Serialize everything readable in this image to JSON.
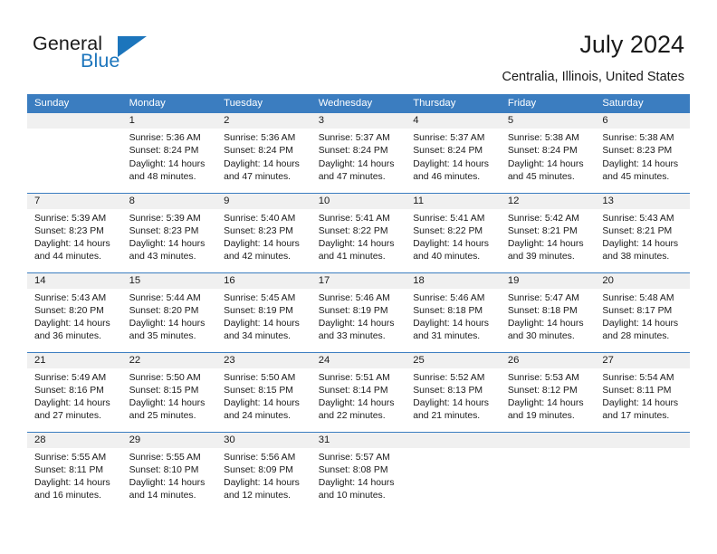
{
  "brand": {
    "name_part1": "General",
    "name_part2": "Blue"
  },
  "header": {
    "title": "July 2024",
    "location": "Centralia, Illinois, United States"
  },
  "colors": {
    "header_blue": "#3b7dc0",
    "brand_blue": "#1c75bc",
    "daynum_band": "#f0f0f0",
    "text": "#1a1a1a"
  },
  "weekdays": [
    "Sunday",
    "Monday",
    "Tuesday",
    "Wednesday",
    "Thursday",
    "Friday",
    "Saturday"
  ],
  "labels": {
    "sunrise_prefix": "Sunrise:",
    "sunset_prefix": "Sunset:",
    "daylight_prefix": "Daylight:"
  },
  "weeks": [
    [
      {
        "day": "",
        "blank": true
      },
      {
        "day": "1",
        "sunrise": "Sunrise: 5:36 AM",
        "sunset": "Sunset: 8:24 PM",
        "daylight1": "Daylight: 14 hours",
        "daylight2": "and 48 minutes."
      },
      {
        "day": "2",
        "sunrise": "Sunrise: 5:36 AM",
        "sunset": "Sunset: 8:24 PM",
        "daylight1": "Daylight: 14 hours",
        "daylight2": "and 47 minutes."
      },
      {
        "day": "3",
        "sunrise": "Sunrise: 5:37 AM",
        "sunset": "Sunset: 8:24 PM",
        "daylight1": "Daylight: 14 hours",
        "daylight2": "and 47 minutes."
      },
      {
        "day": "4",
        "sunrise": "Sunrise: 5:37 AM",
        "sunset": "Sunset: 8:24 PM",
        "daylight1": "Daylight: 14 hours",
        "daylight2": "and 46 minutes."
      },
      {
        "day": "5",
        "sunrise": "Sunrise: 5:38 AM",
        "sunset": "Sunset: 8:24 PM",
        "daylight1": "Daylight: 14 hours",
        "daylight2": "and 45 minutes."
      },
      {
        "day": "6",
        "sunrise": "Sunrise: 5:38 AM",
        "sunset": "Sunset: 8:23 PM",
        "daylight1": "Daylight: 14 hours",
        "daylight2": "and 45 minutes."
      }
    ],
    [
      {
        "day": "7",
        "sunrise": "Sunrise: 5:39 AM",
        "sunset": "Sunset: 8:23 PM",
        "daylight1": "Daylight: 14 hours",
        "daylight2": "and 44 minutes."
      },
      {
        "day": "8",
        "sunrise": "Sunrise: 5:39 AM",
        "sunset": "Sunset: 8:23 PM",
        "daylight1": "Daylight: 14 hours",
        "daylight2": "and 43 minutes."
      },
      {
        "day": "9",
        "sunrise": "Sunrise: 5:40 AM",
        "sunset": "Sunset: 8:23 PM",
        "daylight1": "Daylight: 14 hours",
        "daylight2": "and 42 minutes."
      },
      {
        "day": "10",
        "sunrise": "Sunrise: 5:41 AM",
        "sunset": "Sunset: 8:22 PM",
        "daylight1": "Daylight: 14 hours",
        "daylight2": "and 41 minutes."
      },
      {
        "day": "11",
        "sunrise": "Sunrise: 5:41 AM",
        "sunset": "Sunset: 8:22 PM",
        "daylight1": "Daylight: 14 hours",
        "daylight2": "and 40 minutes."
      },
      {
        "day": "12",
        "sunrise": "Sunrise: 5:42 AM",
        "sunset": "Sunset: 8:21 PM",
        "daylight1": "Daylight: 14 hours",
        "daylight2": "and 39 minutes."
      },
      {
        "day": "13",
        "sunrise": "Sunrise: 5:43 AM",
        "sunset": "Sunset: 8:21 PM",
        "daylight1": "Daylight: 14 hours",
        "daylight2": "and 38 minutes."
      }
    ],
    [
      {
        "day": "14",
        "sunrise": "Sunrise: 5:43 AM",
        "sunset": "Sunset: 8:20 PM",
        "daylight1": "Daylight: 14 hours",
        "daylight2": "and 36 minutes."
      },
      {
        "day": "15",
        "sunrise": "Sunrise: 5:44 AM",
        "sunset": "Sunset: 8:20 PM",
        "daylight1": "Daylight: 14 hours",
        "daylight2": "and 35 minutes."
      },
      {
        "day": "16",
        "sunrise": "Sunrise: 5:45 AM",
        "sunset": "Sunset: 8:19 PM",
        "daylight1": "Daylight: 14 hours",
        "daylight2": "and 34 minutes."
      },
      {
        "day": "17",
        "sunrise": "Sunrise: 5:46 AM",
        "sunset": "Sunset: 8:19 PM",
        "daylight1": "Daylight: 14 hours",
        "daylight2": "and 33 minutes."
      },
      {
        "day": "18",
        "sunrise": "Sunrise: 5:46 AM",
        "sunset": "Sunset: 8:18 PM",
        "daylight1": "Daylight: 14 hours",
        "daylight2": "and 31 minutes."
      },
      {
        "day": "19",
        "sunrise": "Sunrise: 5:47 AM",
        "sunset": "Sunset: 8:18 PM",
        "daylight1": "Daylight: 14 hours",
        "daylight2": "and 30 minutes."
      },
      {
        "day": "20",
        "sunrise": "Sunrise: 5:48 AM",
        "sunset": "Sunset: 8:17 PM",
        "daylight1": "Daylight: 14 hours",
        "daylight2": "and 28 minutes."
      }
    ],
    [
      {
        "day": "21",
        "sunrise": "Sunrise: 5:49 AM",
        "sunset": "Sunset: 8:16 PM",
        "daylight1": "Daylight: 14 hours",
        "daylight2": "and 27 minutes."
      },
      {
        "day": "22",
        "sunrise": "Sunrise: 5:50 AM",
        "sunset": "Sunset: 8:15 PM",
        "daylight1": "Daylight: 14 hours",
        "daylight2": "and 25 minutes."
      },
      {
        "day": "23",
        "sunrise": "Sunrise: 5:50 AM",
        "sunset": "Sunset: 8:15 PM",
        "daylight1": "Daylight: 14 hours",
        "daylight2": "and 24 minutes."
      },
      {
        "day": "24",
        "sunrise": "Sunrise: 5:51 AM",
        "sunset": "Sunset: 8:14 PM",
        "daylight1": "Daylight: 14 hours",
        "daylight2": "and 22 minutes."
      },
      {
        "day": "25",
        "sunrise": "Sunrise: 5:52 AM",
        "sunset": "Sunset: 8:13 PM",
        "daylight1": "Daylight: 14 hours",
        "daylight2": "and 21 minutes."
      },
      {
        "day": "26",
        "sunrise": "Sunrise: 5:53 AM",
        "sunset": "Sunset: 8:12 PM",
        "daylight1": "Daylight: 14 hours",
        "daylight2": "and 19 minutes."
      },
      {
        "day": "27",
        "sunrise": "Sunrise: 5:54 AM",
        "sunset": "Sunset: 8:11 PM",
        "daylight1": "Daylight: 14 hours",
        "daylight2": "and 17 minutes."
      }
    ],
    [
      {
        "day": "28",
        "sunrise": "Sunrise: 5:55 AM",
        "sunset": "Sunset: 8:11 PM",
        "daylight1": "Daylight: 14 hours",
        "daylight2": "and 16 minutes."
      },
      {
        "day": "29",
        "sunrise": "Sunrise: 5:55 AM",
        "sunset": "Sunset: 8:10 PM",
        "daylight1": "Daylight: 14 hours",
        "daylight2": "and 14 minutes."
      },
      {
        "day": "30",
        "sunrise": "Sunrise: 5:56 AM",
        "sunset": "Sunset: 8:09 PM",
        "daylight1": "Daylight: 14 hours",
        "daylight2": "and 12 minutes."
      },
      {
        "day": "31",
        "sunrise": "Sunrise: 5:57 AM",
        "sunset": "Sunset: 8:08 PM",
        "daylight1": "Daylight: 14 hours",
        "daylight2": "and 10 minutes."
      },
      {
        "day": "",
        "blank": true
      },
      {
        "day": "",
        "blank": true
      },
      {
        "day": "",
        "blank": true
      }
    ]
  ]
}
